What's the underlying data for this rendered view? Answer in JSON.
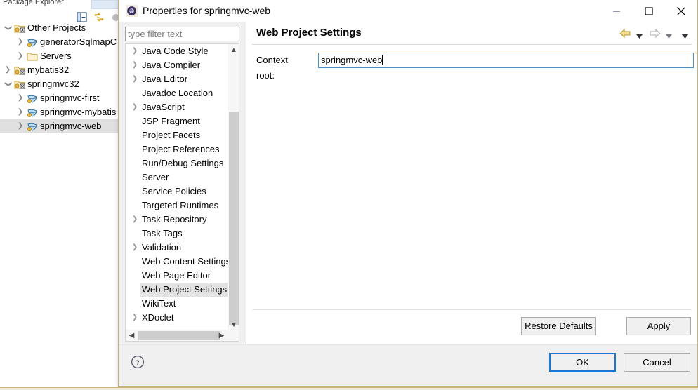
{
  "workbench": {
    "explorer": {
      "view_title": "Package Explorer",
      "toolbar": [
        {
          "name": "collapse-all-icon",
          "label": "Collapse All"
        },
        {
          "name": "link-with-editor-icon",
          "label": "Link with Editor"
        }
      ],
      "tree": [
        {
          "label": "Other Projects",
          "indent": 0,
          "twisty": "expanded",
          "icon": "java-project-icon",
          "selected": false
        },
        {
          "label": "generatorSqlmapC",
          "indent": 1,
          "twisty": "collapsed",
          "icon": "web-project-icon",
          "selected": false
        },
        {
          "label": "Servers",
          "indent": 1,
          "twisty": "collapsed",
          "icon": "folder-icon",
          "selected": false
        },
        {
          "label": "mybatis32",
          "indent": 0,
          "twisty": "collapsed",
          "icon": "java-project-icon",
          "selected": false
        },
        {
          "label": "springmvc32",
          "indent": 0,
          "twisty": "expanded",
          "icon": "java-project-icon",
          "selected": false
        },
        {
          "label": "springmvc-first",
          "indent": 1,
          "twisty": "collapsed",
          "icon": "web-project-icon",
          "selected": false
        },
        {
          "label": "springmvc-mybatis",
          "indent": 1,
          "twisty": "collapsed",
          "icon": "web-project-icon",
          "selected": false
        },
        {
          "label": "springmvc-web",
          "indent": 1,
          "twisty": "collapsed",
          "icon": "web-project-icon",
          "selected": true
        }
      ]
    }
  },
  "dialog": {
    "title": "Properties for springmvc-web",
    "icon": "eclipse-app-icon",
    "window_buttons": {
      "minimize": "minimize-icon",
      "maximize": "maximize-icon",
      "close": "close-icon"
    },
    "filter": {
      "value": "",
      "placeholder": "type filter text"
    },
    "tree": [
      {
        "label": "Java Code Style",
        "expandable": true,
        "selected": false
      },
      {
        "label": "Java Compiler",
        "expandable": true,
        "selected": false
      },
      {
        "label": "Java Editor",
        "expandable": true,
        "selected": false
      },
      {
        "label": "Javadoc Location",
        "expandable": false,
        "selected": false
      },
      {
        "label": "JavaScript",
        "expandable": true,
        "selected": false
      },
      {
        "label": "JSP Fragment",
        "expandable": false,
        "selected": false
      },
      {
        "label": "Project Facets",
        "expandable": false,
        "selected": false
      },
      {
        "label": "Project References",
        "expandable": false,
        "selected": false
      },
      {
        "label": "Run/Debug Settings",
        "expandable": false,
        "selected": false
      },
      {
        "label": "Server",
        "expandable": false,
        "selected": false
      },
      {
        "label": "Service Policies",
        "expandable": false,
        "selected": false
      },
      {
        "label": "Targeted Runtimes",
        "expandable": false,
        "selected": false
      },
      {
        "label": "Task Repository",
        "expandable": true,
        "selected": false
      },
      {
        "label": "Task Tags",
        "expandable": false,
        "selected": false
      },
      {
        "label": "Validation",
        "expandable": true,
        "selected": false
      },
      {
        "label": "Web Content Settings",
        "expandable": false,
        "selected": false
      },
      {
        "label": "Web Page Editor",
        "expandable": false,
        "selected": false
      },
      {
        "label": "Web Project Settings",
        "expandable": false,
        "selected": true
      },
      {
        "label": "WikiText",
        "expandable": false,
        "selected": false
      },
      {
        "label": "XDoclet",
        "expandable": true,
        "selected": false
      }
    ],
    "page": {
      "title": "Web Project Settings",
      "nav": [
        {
          "name": "back-arrow-icon",
          "label": "Back"
        },
        {
          "name": "back-dropdown-icon",
          "label": "Back history"
        },
        {
          "name": "forward-arrow-icon",
          "label": "Forward"
        },
        {
          "name": "forward-dropdown-icon",
          "label": "Forward history"
        },
        {
          "name": "view-menu-icon",
          "label": "Menu"
        }
      ],
      "context_root": {
        "label": "Context root:",
        "value": "springmvc-web",
        "placeholder": ""
      },
      "buttons": {
        "restore_defaults": "Restore Defaults",
        "restore_defaults_mnemonic": "D",
        "apply": "Apply",
        "apply_mnemonic": "A"
      }
    },
    "footer": {
      "help_icon": "help-icon",
      "ok": "OK",
      "cancel": "Cancel"
    }
  }
}
